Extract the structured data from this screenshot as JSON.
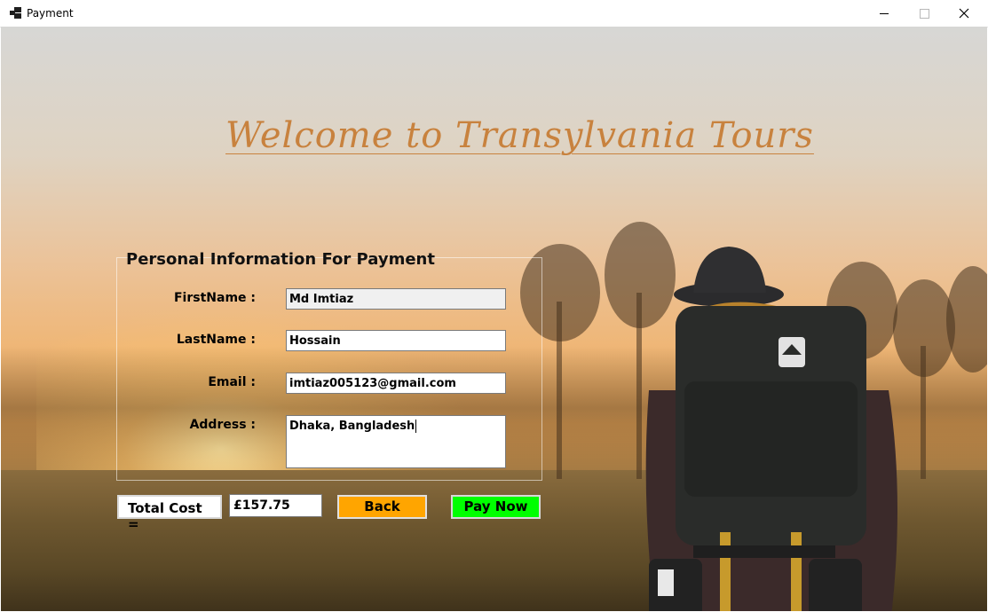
{
  "window": {
    "title": "Payment",
    "controls": [
      "minimize-icon",
      "maximize-icon",
      "close-icon"
    ]
  },
  "header": {
    "welcome": "Welcome to Transylvania Tours"
  },
  "form": {
    "group_title": "Personal Information For Payment",
    "firstname_label": "FirstName :",
    "firstname_value": "Md Imtiaz",
    "lastname_label": "LastName :",
    "lastname_value": "Hossain",
    "email_label": "Email :",
    "email_value": "imtiaz005123@gmail.com",
    "address_label": "Address :",
    "address_value": "Dhaka, Bangladesh"
  },
  "footer": {
    "total_label": "Total Cost =",
    "total_value": "£157.75",
    "back_label": "Back",
    "pay_label": "Pay Now"
  },
  "colors": {
    "title_color": "#c8823e",
    "back_button": "#ffa500",
    "pay_button": "#00ff00"
  }
}
